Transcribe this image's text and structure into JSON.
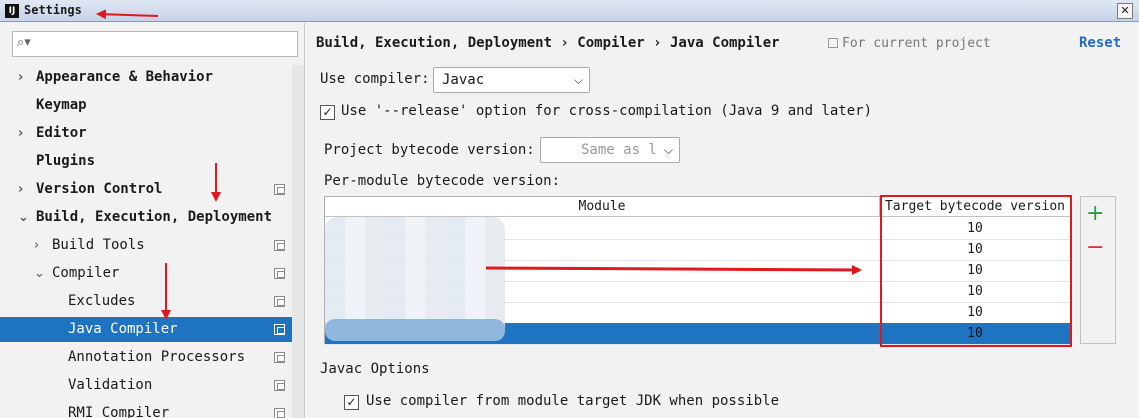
{
  "window": {
    "title": "Settings",
    "app_icon": "IJ",
    "close_glyph": "✕"
  },
  "sidebar": {
    "search": {
      "value": "",
      "icon": "search-icon"
    },
    "items": [
      {
        "label": "Appearance & Behavior",
        "arrow": "›",
        "bold": true,
        "has_copy": false
      },
      {
        "label": "Keymap",
        "arrow": "",
        "bold": true,
        "has_copy": false
      },
      {
        "label": "Editor",
        "arrow": "›",
        "bold": true,
        "has_copy": false
      },
      {
        "label": "Plugins",
        "arrow": "",
        "bold": true,
        "has_copy": false
      },
      {
        "label": "Version Control",
        "arrow": "›",
        "bold": true,
        "has_copy": true
      },
      {
        "label": "Build, Execution, Deployment",
        "arrow": "⌄",
        "bold": true,
        "has_copy": false
      },
      {
        "label": "Build Tools",
        "arrow": "›",
        "bold": false,
        "has_copy": true
      },
      {
        "label": "Compiler",
        "arrow": "⌄",
        "bold": false,
        "has_copy": true
      },
      {
        "label": "Excludes",
        "arrow": "",
        "bold": false,
        "has_copy": true
      },
      {
        "label": "Java Compiler",
        "arrow": "",
        "bold": false,
        "has_copy": true,
        "selected": true
      },
      {
        "label": "Annotation Processors",
        "arrow": "",
        "bold": false,
        "has_copy": true
      },
      {
        "label": "Validation",
        "arrow": "",
        "bold": false,
        "has_copy": true
      },
      {
        "label": "RMI Compiler",
        "arrow": "",
        "bold": false,
        "has_copy": true
      }
    ]
  },
  "main": {
    "breadcrumb": "Build, Execution, Deployment › Compiler › Java Compiler",
    "scope_label": "For current project",
    "reset_label": "Reset",
    "use_compiler_label": "Use compiler:",
    "use_compiler_value": "Javac",
    "release_option_label": "Use '--release' option for cross-compilation (Java 9 and later)",
    "release_option_checked": true,
    "project_bytecode_label": "Project bytecode version:",
    "project_bytecode_value": "Same as l",
    "per_module_label": "Per-module bytecode version:",
    "table": {
      "columns": [
        "Module",
        "Target bytecode version"
      ],
      "rows": [
        {
          "module": "",
          "version": "10"
        },
        {
          "module": "",
          "version": "10"
        },
        {
          "module": "",
          "version": "10"
        },
        {
          "module": "",
          "version": "10"
        },
        {
          "module": "",
          "version": "10"
        },
        {
          "module": "",
          "version": "10",
          "selected": true
        }
      ]
    },
    "add_glyph": "+",
    "remove_glyph": "−",
    "javac_options_label": "Javac Options",
    "module_jdk_label": "Use compiler from module target JDK when possible",
    "module_jdk_checked": true
  },
  "colors": {
    "selection": "#1f74c2",
    "annotation_red": "#e0191e",
    "link": "#2769c5",
    "add_green": "#2f9c3a"
  }
}
